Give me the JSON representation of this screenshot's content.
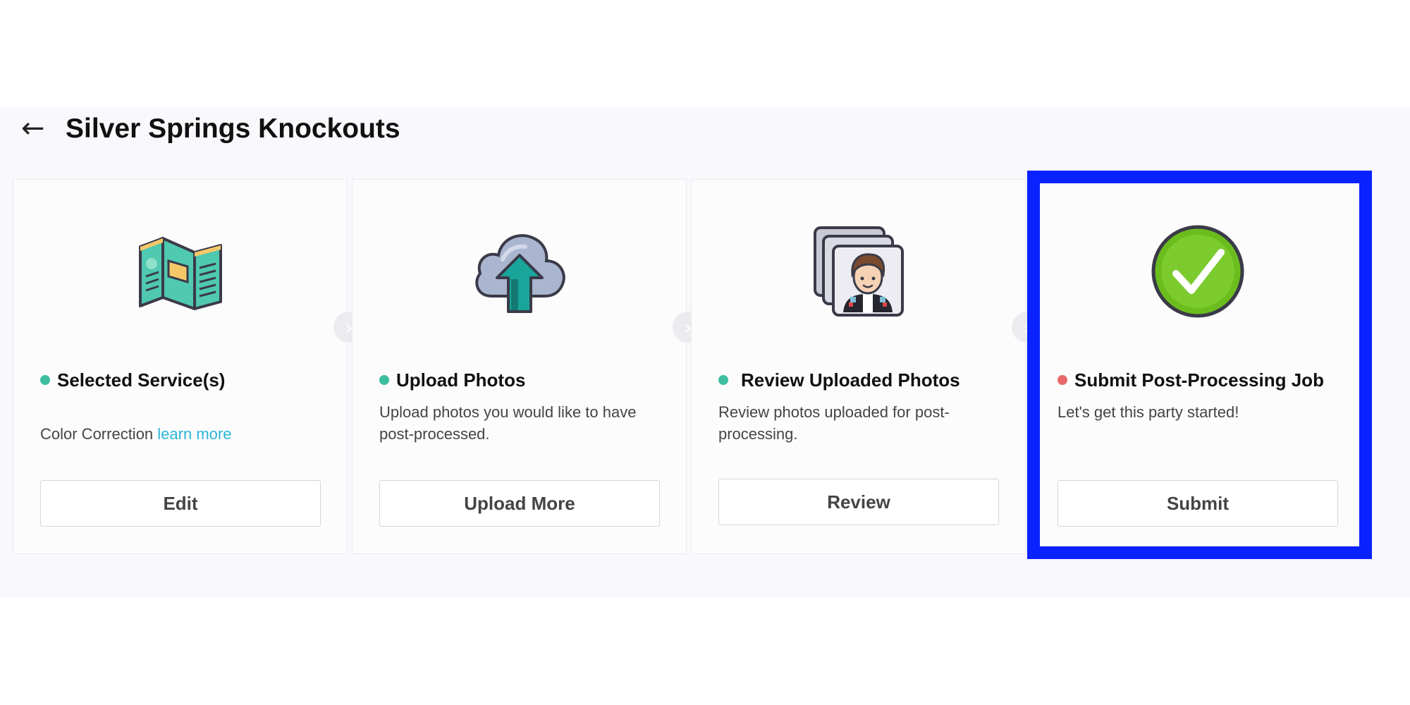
{
  "header": {
    "back_icon": "←",
    "title": "Silver Springs Knockouts"
  },
  "steps": [
    {
      "icon": "brochure-icon",
      "title": "Selected Service(s)",
      "status_color": "#3dbf9f",
      "desc_text": "Color Correction ",
      "desc_link": "learn more",
      "button": "Edit"
    },
    {
      "icon": "cloud-upload-icon",
      "title": "Upload Photos",
      "status_color": "#3dbf9f",
      "desc_text": "Upload photos you would like to have post-processed.",
      "button": "Upload More"
    },
    {
      "icon": "photo-stack-icon",
      "title": "Review Uploaded Photos",
      "status_color": "#3dbf9f",
      "desc_text": "Review photos uploaded for post-processing.",
      "button": "Review"
    },
    {
      "icon": "check-circle-icon",
      "title": "Submit Post-Processing Job",
      "status_color": "#e86a6a",
      "desc_text": "Let's get this party started!",
      "button": "Submit"
    }
  ],
  "connector_icon": "›",
  "colors": {
    "accent_link": "#2bb6d8",
    "highlight_border": "#0a22ff",
    "panel_bg": "#f9f8fc"
  }
}
